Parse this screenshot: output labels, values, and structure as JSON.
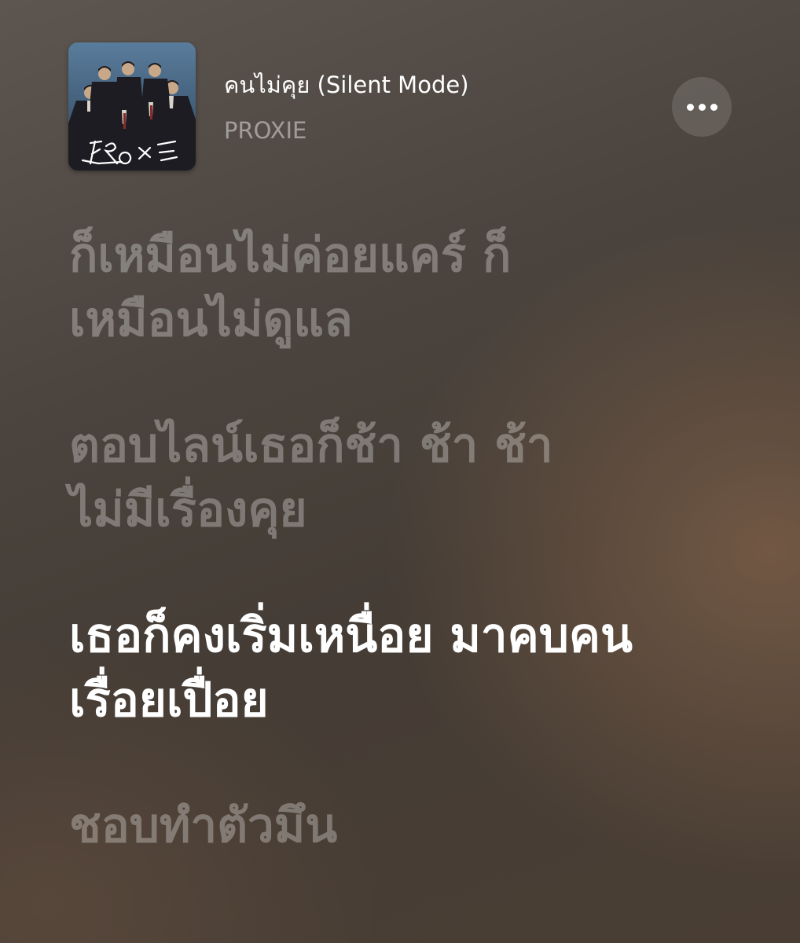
{
  "now_playing": {
    "title": "คนไม่คุย (Silent Mode)",
    "artist": "PROXIE",
    "album_art_text": "PROXIE",
    "more_icon": "ellipsis-horizontal-icon"
  },
  "lyrics": {
    "lines": [
      {
        "text": "ก็เหมือนไม่ค่อยแคร์ ก็เหมือนไม่ดูแล",
        "state": "past"
      },
      {
        "text": "ตอบไลน์เธอก็ช้า ช้า ช้า ไม่มีเรื่องคุย",
        "state": "past"
      },
      {
        "text": "เธอก็คงเริ่มเหนื่อย มาคบคนเรื่อยเปื่อย",
        "state": "current"
      },
      {
        "text": "ชอบทำตัวมึน",
        "state": "upcoming"
      }
    ]
  },
  "colors": {
    "active_lyric": "#ffffff",
    "inactive_lyric": "rgba(255,255,255,0.3)",
    "background": "#4b443e"
  }
}
